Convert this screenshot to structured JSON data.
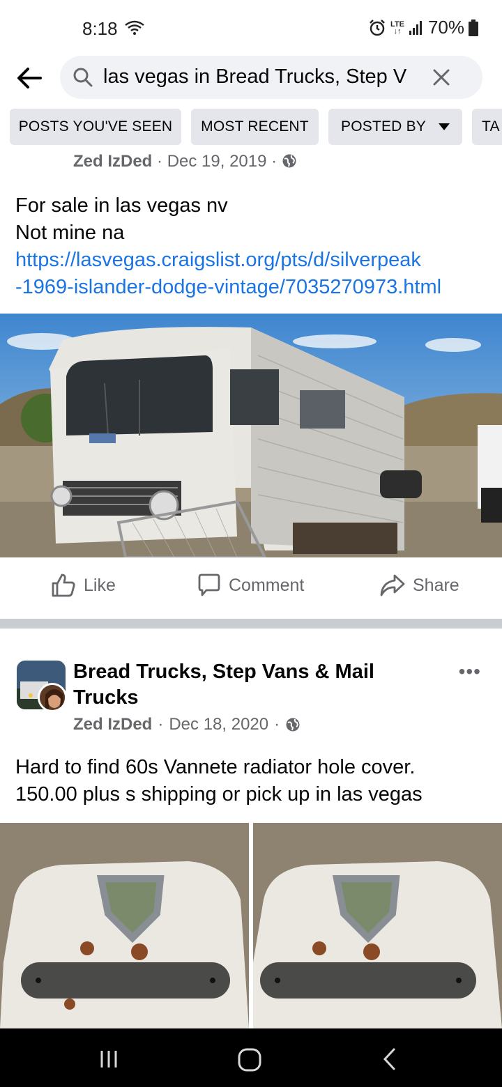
{
  "status_bar": {
    "time": "8:18",
    "lte": "LTE",
    "battery": "70%"
  },
  "search": {
    "query": "las vegas in Bread Trucks, Step V"
  },
  "filters": [
    {
      "label": "POSTS YOU'VE SEEN"
    },
    {
      "label": "MOST RECENT"
    },
    {
      "label": "POSTED BY"
    },
    {
      "label": "TA"
    }
  ],
  "post1": {
    "author": "Zed IzDed",
    "date": "Dec 19, 2019",
    "text_line1": "For sale in las vegas nv",
    "text_line2": "Not mine na",
    "link_line1": "https://lasvegas.craigslist.org/pts/d/silverpeak",
    "link_line2": "-1969-islander-dodge-vintage/7035270973.html"
  },
  "actions": {
    "like": "Like",
    "comment": "Comment",
    "share": "Share"
  },
  "post2": {
    "group_name": "Bread Trucks, Step Vans & Mail Trucks",
    "author": "Zed IzDed",
    "date": "Dec 18, 2020",
    "text_line1": "Hard to find 60s Vannete radiator hole cover.",
    "text_line2": "150.00 plus s shipping or pick up in las vegas"
  },
  "colors": {
    "link": "#1b74e4",
    "chip_bg": "#e4e6eb",
    "search_bg": "#f0f2f5",
    "meta_text": "#65676b",
    "separator": "#c9ccd1"
  }
}
